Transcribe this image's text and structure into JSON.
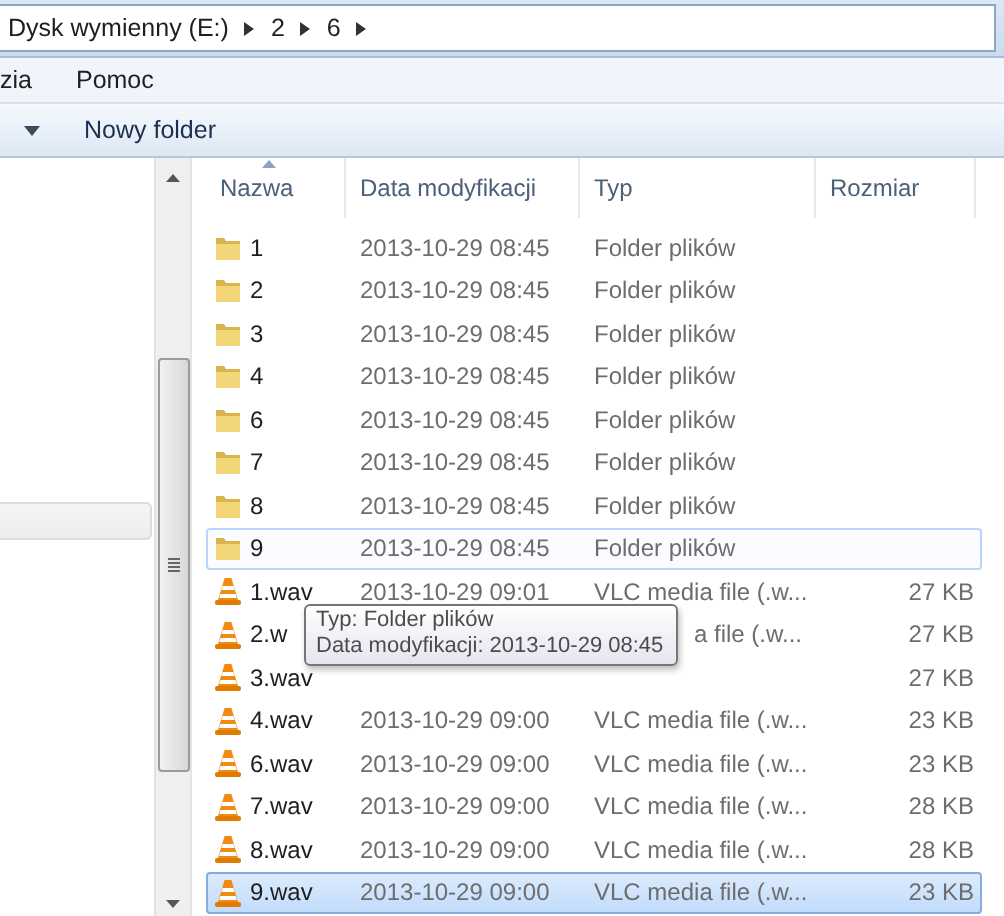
{
  "address_bar": {
    "crumbs": [
      "Dysk wymienny (E:)",
      "2",
      "6"
    ]
  },
  "menu": [
    "zia",
    "Pomoc"
  ],
  "toolbar": {
    "buttons": [
      "Nowy folder"
    ]
  },
  "table": {
    "columns": [
      {
        "label": "Nazwa",
        "sorted": true
      },
      {
        "label": "Data modyfikacji",
        "sorted": false
      },
      {
        "label": "Typ",
        "sorted": false
      },
      {
        "label": "Rozmiar",
        "sorted": false
      }
    ],
    "rows": [
      {
        "kind": "folder",
        "name": "1",
        "date": "2013-10-29 08:45",
        "type": "Folder plików",
        "selected": false,
        "hovered": false
      },
      {
        "kind": "folder",
        "name": "2",
        "date": "2013-10-29 08:45",
        "type": "Folder plików",
        "selected": false,
        "hovered": false
      },
      {
        "kind": "folder",
        "name": "3",
        "date": "2013-10-29 08:45",
        "type": "Folder plików",
        "selected": false,
        "hovered": false
      },
      {
        "kind": "folder",
        "name": "4",
        "date": "2013-10-29 08:45",
        "type": "Folder plików",
        "selected": false,
        "hovered": false
      },
      {
        "kind": "folder",
        "name": "6",
        "date": "2013-10-29 08:45",
        "type": "Folder plików",
        "selected": false,
        "hovered": false
      },
      {
        "kind": "folder",
        "name": "7",
        "date": "2013-10-29 08:45",
        "type": "Folder plików",
        "selected": false,
        "hovered": false
      },
      {
        "kind": "folder",
        "name": "8",
        "date": "2013-10-29 08:45",
        "type": "Folder plików",
        "selected": false,
        "hovered": false
      },
      {
        "kind": "folder",
        "name": "9",
        "date": "2013-10-29 08:45",
        "type": "Folder plików",
        "selected": false,
        "hovered": true
      },
      {
        "kind": "file",
        "name": "1.wav",
        "date": "2013-10-29 09:01",
        "type": "VLC media file (.w...",
        "size": "27 KB",
        "selected": false,
        "hovered": false
      },
      {
        "kind": "file",
        "name": "2.w",
        "type": "a file (.w...",
        "covered": true,
        "size": "27 KB",
        "selected": false,
        "hovered": false
      },
      {
        "kind": "file",
        "name": "3.wav",
        "size": "27 KB",
        "selected": false,
        "hovered": false
      },
      {
        "kind": "file",
        "name": "4.wav",
        "date": "2013-10-29 09:00",
        "type": "VLC media file (.w...",
        "size": "23 KB",
        "selected": false,
        "hovered": false
      },
      {
        "kind": "file",
        "name": "6.wav",
        "date": "2013-10-29 09:00",
        "type": "VLC media file (.w...",
        "size": "23 KB",
        "selected": false,
        "hovered": false
      },
      {
        "kind": "file",
        "name": "7.wav",
        "date": "2013-10-29 09:00",
        "type": "VLC media file (.w...",
        "size": "28 KB",
        "selected": false,
        "hovered": false
      },
      {
        "kind": "file",
        "name": "8.wav",
        "date": "2013-10-29 09:00",
        "type": "VLC media file (.w...",
        "size": "28 KB",
        "selected": false,
        "hovered": false
      },
      {
        "kind": "file",
        "name": "9.wav",
        "date": "2013-10-29 09:00",
        "type": "VLC media file (.w...",
        "size": "23 KB",
        "selected": true,
        "hovered": false
      }
    ]
  },
  "tooltip": {
    "lines": [
      "Typ: Folder plików",
      "Data modyfikacji: 2013-10-29 08:45"
    ]
  }
}
